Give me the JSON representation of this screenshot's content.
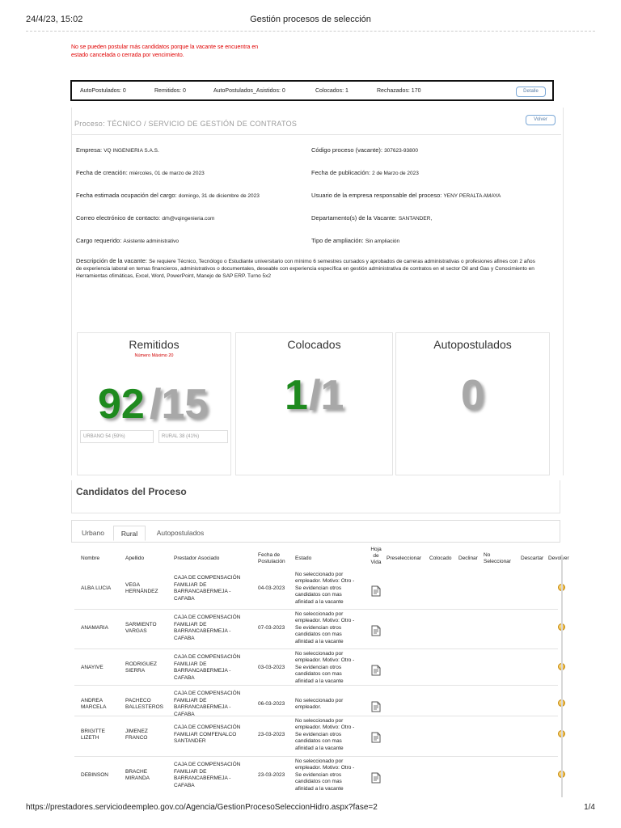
{
  "print_header": {
    "datetime": "24/4/23, 15:02",
    "title": "Gestión procesos de selección"
  },
  "warning": {
    "line1": "No se pueden postular más candidatos porque la vacante se encuentra en",
    "line2": "estado cancelada o cerrada por vencimiento."
  },
  "stats": {
    "autopostulados": "AutoPostulados: 0",
    "remitidos": "Remitidos: 0",
    "asistidos": "AutoPostulados_Asistidos: 0",
    "colocados": "Colocados: 1",
    "rechazados": "Rechazados: 170",
    "detalle_button": "Detalle"
  },
  "process": {
    "title": "Proceso: TÉCNICO / SERVICIO DE GESTIÓN DE CONTRATOS",
    "volver_button": "Volver",
    "fields": [
      {
        "label": "Empresa: ",
        "value": "VQ INGENIERIA S.A.S."
      },
      {
        "label": "Código proceso (vacante): ",
        "value": "307623-93800"
      },
      {
        "label": "Fecha de creación: ",
        "value": "miércoles, 01 de marzo de 2023"
      },
      {
        "label": "Fecha de publicación: ",
        "value": "2 de Marzo de 2023"
      },
      {
        "label": "Fecha estimada ocupación del cargo: ",
        "value": "domingo, 31 de diciembre de 2023"
      },
      {
        "label": "Usuario de la empresa responsable del proceso: ",
        "value": "YENY PERALTA AMAYA"
      },
      {
        "label": "Correo electrónico de contacto: ",
        "value": "drh@vqingenieria.com"
      },
      {
        "label": "Departamento(s) de la Vacante: ",
        "value": "SANTANDER,"
      },
      {
        "label": "Cargo requerido: ",
        "value": "Asistente administrativo"
      },
      {
        "label": "Tipo de ampliación: ",
        "value": "Sin ampliación"
      }
    ],
    "description_label": "Descripción de la vacante: ",
    "description_value": "Se requiere Técnico, Tecnólogo o Estudiante universitario con mínimo 6 semestres cursados y aprobados de carreras administrativas o profesiones afines con 2 años de experiencia laboral en temas financieros, administrativos o documentales, deseable con experiencia específica en gestión administrativa de contratos en el sector Oil and Gas y Conocimiento en Herramientas ofimáticas, Excel, Word, PowerPoint, Manejo de SAP ERP. Turno 5x2"
  },
  "cards": {
    "remitidos": {
      "title": "Remitidos",
      "subtitle": "Número Máximo 20",
      "value": "92",
      "slash_total": "/15",
      "urbano": "URBANO 54 (59%)",
      "rural": "RURAL 38 (41%)"
    },
    "colocados": {
      "title": "Colocados",
      "value": "1",
      "slash_total": "/1"
    },
    "autopostulados": {
      "title": "Autopostulados",
      "value": "0"
    }
  },
  "candidates": {
    "title": "Candidatos del Proceso",
    "tabs": [
      "Urbano",
      "Rural",
      "Autopostulados"
    ],
    "columns": {
      "nombre": "Nombre",
      "apellido": "Apellido",
      "prestador": "Prestador Asociado",
      "fecha_line1": "Fecha de",
      "fecha_line2": "Postulación",
      "estado": "Estado",
      "hoja_line1": "Hoja",
      "hoja_line2": "de",
      "hoja_line3": "Vida",
      "preseleccionar": "Preseleccionar",
      "colocado": "Colocado",
      "declinar": "Declinar",
      "no_sel_line1": "No",
      "no_sel_line2": "Seleccionar",
      "descartar": "Descartar",
      "devolver": "Devolver"
    },
    "rows": [
      {
        "nombre": [
          "ALBA LUCIA"
        ],
        "apellido": [
          "VEGA",
          "HERNÁNDEZ"
        ],
        "prestador": [
          "CAJA DE COMPENSACIÓN",
          "FAMILIAR DE",
          "BARRANCABERMEJA -",
          "CAFABA"
        ],
        "fecha": "04-03-2023",
        "estado": [
          "No seleccionado por",
          "empleador. Motivo: Otro -",
          "Se evidencian otros",
          "candidatos con mas",
          "afinidad a la vacante"
        ]
      },
      {
        "nombre": [
          "ANAMARIA"
        ],
        "apellido": [
          "SARMIENTO",
          "VARGAS"
        ],
        "prestador": [
          "CAJA DE COMPENSACIÓN",
          "FAMILIAR DE",
          "BARRANCABERMEJA -",
          "CAFABA"
        ],
        "fecha": "07-03-2023",
        "estado": [
          "No seleccionado por",
          "empleador. Motivo: Otro -",
          "Se evidencian otros",
          "candidatos con mas",
          "afinidad a la vacante"
        ]
      },
      {
        "nombre": [
          "ANAYIVE"
        ],
        "apellido": [
          "RODRIGUEZ",
          "SIERRA"
        ],
        "prestador": [
          "CAJA DE COMPENSACIÓN",
          "FAMILIAR DE",
          "BARRANCABERMEJA -",
          "CAFABA"
        ],
        "fecha": "03-03-2023",
        "estado": [
          "No seleccionado por",
          "empleador. Motivo: Otro -",
          "Se evidencian otros",
          "candidatos con mas",
          "afinidad a la vacante"
        ]
      },
      {
        "nombre": [
          "ANDREA",
          "MARCELA"
        ],
        "apellido": [
          "PACHECO",
          "BALLESTEROS"
        ],
        "prestador": [
          "CAJA DE COMPENSACIÓN",
          "FAMILIAR DE",
          "BARRANCABERMEJA -",
          "CAFABA"
        ],
        "fecha": "06-03-2023",
        "estado": [
          "No seleccionado por",
          "empleador."
        ]
      },
      {
        "nombre": [
          "BRIGITTE",
          "LIZETH"
        ],
        "apellido": [
          "JIMENEZ",
          "FRANCO"
        ],
        "prestador": [
          "CAJA DE COMPENSACIÓN",
          "FAMILIAR COMFENALCO",
          "SANTANDER"
        ],
        "fecha": "23-03-2023",
        "estado": [
          "No seleccionado por",
          "empleador. Motivo: Otro -",
          "Se evidencian otros",
          "candidatos con mas",
          "afinidad a la vacante"
        ]
      },
      {
        "nombre": [
          "DEBINSON"
        ],
        "apellido": [
          "BRACHE",
          "MIRANDA"
        ],
        "prestador": [
          "CAJA DE COMPENSACIÓN",
          "FAMILIAR DE",
          "BARRANCABERMEJA -",
          "CAFABA"
        ],
        "fecha": "23-03-2023",
        "estado": [
          "No seleccionado por",
          "empleador. Motivo: Otro -",
          "Se evidencian otros",
          "candidatos con mas",
          "afinidad a la vacante"
        ]
      }
    ]
  },
  "footer": {
    "url": "https://prestadores.serviciodeempleo.gov.co/Agencia/GestionProcesoSeleccionHidro.aspx?fase=2",
    "page": "1/4"
  },
  "colors": {
    "warning": "#e00000",
    "big_green": "#1e8a1e",
    "big_gray": "#a8a8a8",
    "subtitle_red": "#d00000",
    "knob": "#e3a21a"
  }
}
